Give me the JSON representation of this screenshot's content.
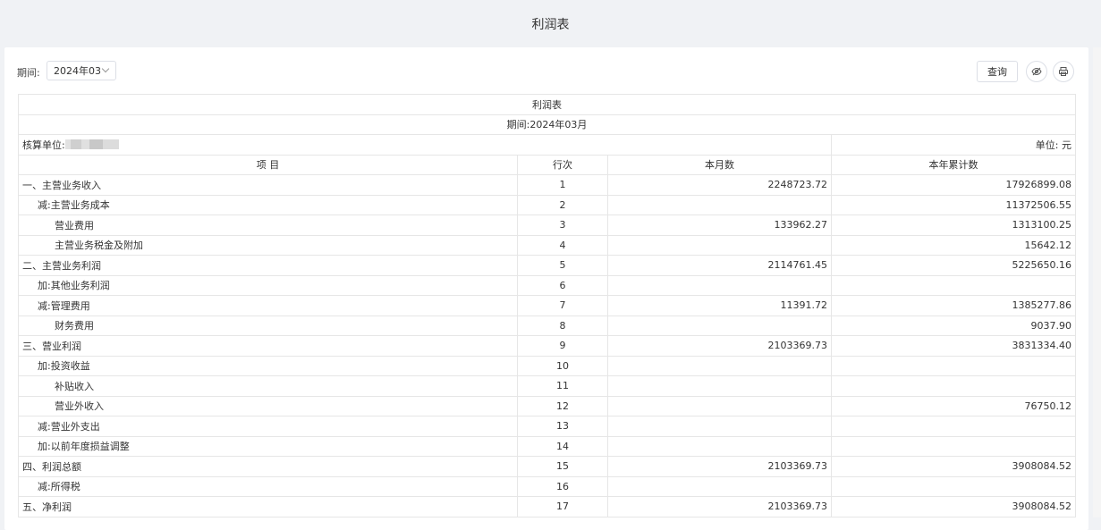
{
  "page": {
    "title": "利润表"
  },
  "toolbar": {
    "period_label": "期间:",
    "period_value": "2024年03",
    "query_label": "查询"
  },
  "report": {
    "title": "利润表",
    "period": "期间:2024年03月",
    "unit_label": "核算单位:",
    "currency": "单位: 元",
    "headers": [
      "项 目",
      "行次",
      "本月数",
      "本年累计数"
    ],
    "rows": [
      {
        "item": "一、主营业务收入",
        "line": "1",
        "month": "2248723.72",
        "ytd": "17926899.08"
      },
      {
        "item": "减:主营业务成本",
        "line": "2",
        "month": "",
        "ytd": "11372506.55"
      },
      {
        "item": "营业费用",
        "line": "3",
        "month": "133962.27",
        "ytd": "1313100.25"
      },
      {
        "item": "主营业务税金及附加",
        "line": "4",
        "month": "",
        "ytd": "15642.12"
      },
      {
        "item": "二、主营业务利润",
        "line": "5",
        "month": "2114761.45",
        "ytd": "5225650.16"
      },
      {
        "item": "加:其他业务利润",
        "line": "6",
        "month": "",
        "ytd": ""
      },
      {
        "item": "减:管理费用",
        "line": "7",
        "month": "11391.72",
        "ytd": "1385277.86"
      },
      {
        "item": "财务费用",
        "line": "8",
        "month": "",
        "ytd": "9037.90"
      },
      {
        "item": "三、营业利润",
        "line": "9",
        "month": "2103369.73",
        "ytd": "3831334.40"
      },
      {
        "item": "加:投资收益",
        "line": "10",
        "month": "",
        "ytd": ""
      },
      {
        "item": "补贴收入",
        "line": "11",
        "month": "",
        "ytd": ""
      },
      {
        "item": "营业外收入",
        "line": "12",
        "month": "",
        "ytd": "76750.12"
      },
      {
        "item": "减:营业外支出",
        "line": "13",
        "month": "",
        "ytd": ""
      },
      {
        "item": "加:以前年度损益调整",
        "line": "14",
        "month": "",
        "ytd": ""
      },
      {
        "item": "四、利润总额",
        "line": "15",
        "month": "2103369.73",
        "ytd": "3908084.52"
      },
      {
        "item": "减:所得税",
        "line": "16",
        "month": "",
        "ytd": ""
      },
      {
        "item": "五、净利润",
        "line": "17",
        "month": "2103369.73",
        "ytd": "3908084.52"
      }
    ]
  }
}
